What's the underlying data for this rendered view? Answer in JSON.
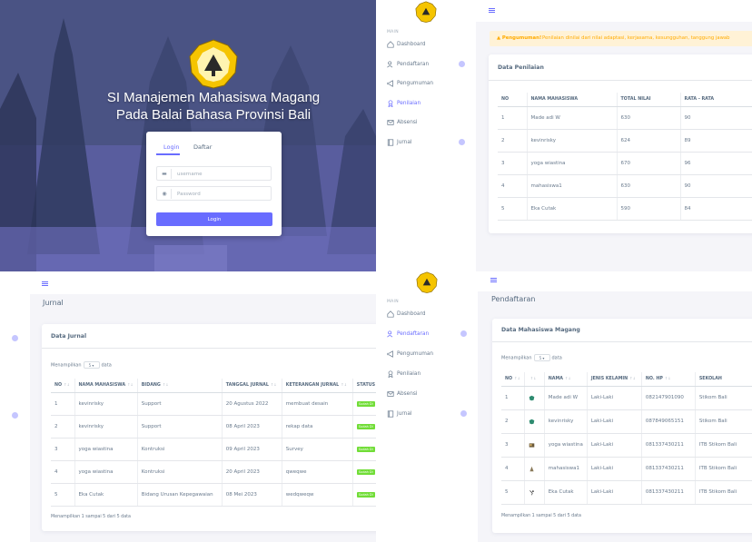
{
  "login": {
    "title_line1": "SI Manajemen Mahasiswa Magang",
    "title_line2": "Pada Balai Bahasa Provinsi Bali",
    "tab_login": "Login",
    "tab_register": "Daftar",
    "username_placeholder": "username",
    "password_placeholder": "Password",
    "login_button": "Login"
  },
  "sidebar": {
    "section": "MAIN",
    "items": [
      {
        "label": "Dashboard",
        "icon": "home-icon"
      },
      {
        "label": "Pendaftaran",
        "icon": "users-icon",
        "badge": ""
      },
      {
        "label": "Pengumuman",
        "icon": "megaphone-icon"
      },
      {
        "label": "Penilaian",
        "icon": "award-icon"
      },
      {
        "label": "Absensi",
        "icon": "mail-icon"
      },
      {
        "label": "Jurnal",
        "icon": "book-icon",
        "badge": ""
      }
    ]
  },
  "penilaian": {
    "announcement_label": "Pengumuman!",
    "announcement_text": "Penilaian dinilai dari nilai adaptasi, kerjasama, kesungguhan, tanggung jawab",
    "card_title": "Data Penilaian",
    "columns": [
      "NO",
      "NAMA MAHASISWA",
      "TOTAL NILAI",
      "RATA - RATA"
    ],
    "rows": [
      [
        "1",
        "Made adi W",
        "630",
        "90"
      ],
      [
        "2",
        "kevinrisky",
        "624",
        "89"
      ],
      [
        "3",
        "yoga wiastina",
        "670",
        "96"
      ],
      [
        "4",
        "mahasiswa1",
        "630",
        "90"
      ],
      [
        "5",
        "Eka Cutak",
        "590",
        "84"
      ]
    ]
  },
  "jurnal": {
    "page_title": "Jurnal",
    "card_title": "Data Jurnal",
    "show_prefix": "Menampilkan",
    "show_value": "5",
    "show_suffix": "data",
    "columns": [
      "NO",
      "NAMA MAHASISWA",
      "BIDANG",
      "TANGGAL JURNAL",
      "KETERANGAN JURNAL",
      "STATUS"
    ],
    "rows": [
      [
        "1",
        "kevinrisky",
        "Support",
        "20 Agustus 2022",
        "membuat desain",
        "Sudah Di"
      ],
      [
        "2",
        "kevinrisky",
        "Support",
        "08 April 2023",
        "rekap data",
        "Sudah Di"
      ],
      [
        "3",
        "yoga wiastina",
        "Kontruksi",
        "09 April 2023",
        "Survey",
        "Sudah Di"
      ],
      [
        "4",
        "yoga wiastina",
        "Kontruksi",
        "20 April 2023",
        "qweqwe",
        "Sudah Di"
      ],
      [
        "5",
        "Eka Cutak",
        "Bidang Urusan Kepegawaian",
        "08 Mei 2023",
        "wedqweqw",
        "Sudah Di"
      ]
    ],
    "footer": "Menampilkan 1 sampai 5 dari 5 data"
  },
  "pendaftaran": {
    "page_title": "Pendaftaran",
    "card_title": "Data Mahasiswa Magang",
    "show_prefix": "Menampilkan",
    "show_value": "5",
    "show_suffix": "data",
    "columns": [
      "NO",
      "",
      "NAMA",
      "JENIS KELAMIN",
      "NO. HP",
      "SEKOLAH"
    ],
    "rows": [
      [
        "1",
        "avatar-1",
        "Made adi W",
        "Laki-Laki",
        "082147901090",
        "Stikom Bali"
      ],
      [
        "2",
        "avatar-2",
        "kevinrisky",
        "Laki-Laki",
        "087849065151",
        "Stikom Bali"
      ],
      [
        "3",
        "avatar-3",
        "yoga wiastina",
        "Laki-Laki",
        "081337430211",
        "ITB Stikom Bali"
      ],
      [
        "4",
        "avatar-4",
        "mahasiswa1",
        "Laki-Laki",
        "081337430211",
        "ITB Stikom Bali"
      ],
      [
        "5",
        "avatar-5",
        "Eka Cutak",
        "Laki-Laki",
        "081337430211",
        "ITB Stikom Bali"
      ]
    ],
    "footer": "Menampilkan 1 sampai 5 dari 5 data"
  },
  "colors": {
    "primary": "#696cff",
    "status_green": "#71dd37",
    "warning": "#ffab00",
    "logo_yellow": "#f5c400"
  }
}
